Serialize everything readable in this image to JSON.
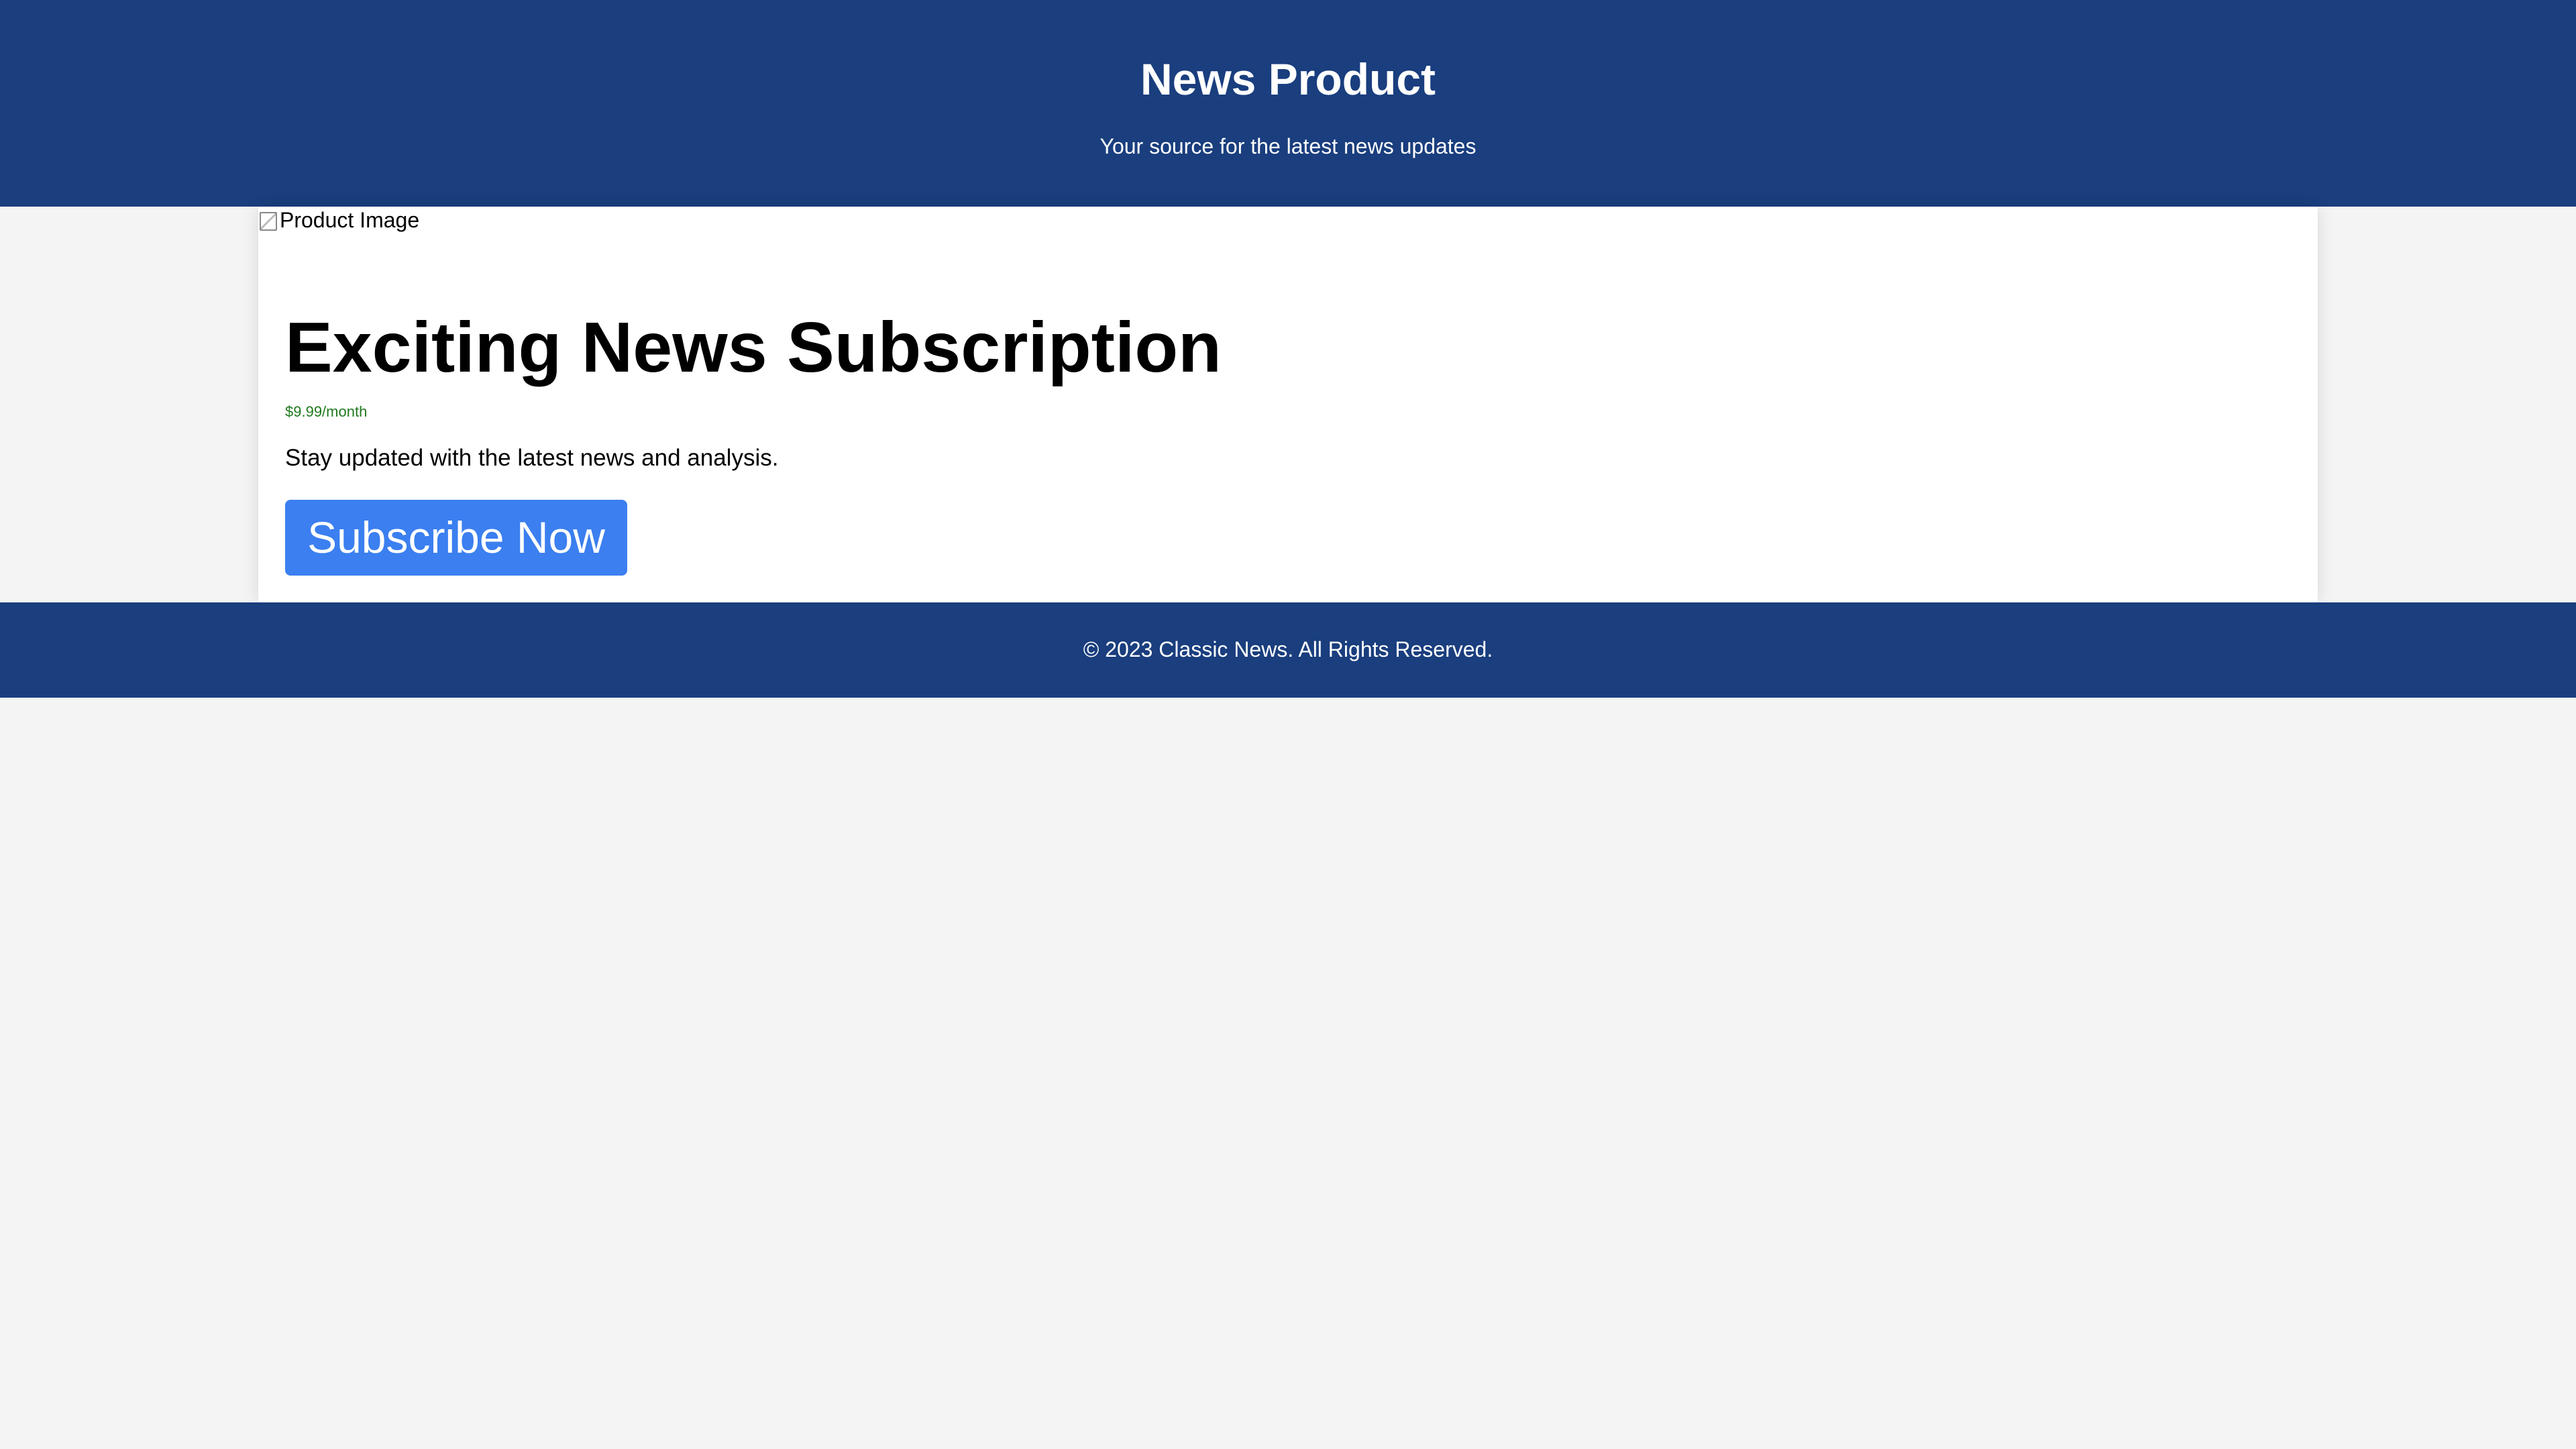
{
  "header": {
    "title": "News Product",
    "tagline": "Your source for the latest news updates"
  },
  "product": {
    "image_alt": "Product Image",
    "image_icon": "broken-image-icon",
    "title": "Exciting News Subscription",
    "price": "$9.99/month",
    "description": "Stay updated with the latest news and analysis.",
    "button_label": "Subscribe Now"
  },
  "footer": {
    "copyright": "© 2023 Classic News. All Rights Reserved."
  },
  "colors": {
    "header_background": "#1a3e7e",
    "page_background": "#f4f4f4",
    "card_background": "#ffffff",
    "price_text": "#1f7a1f",
    "button_background": "#3b7ff0"
  }
}
